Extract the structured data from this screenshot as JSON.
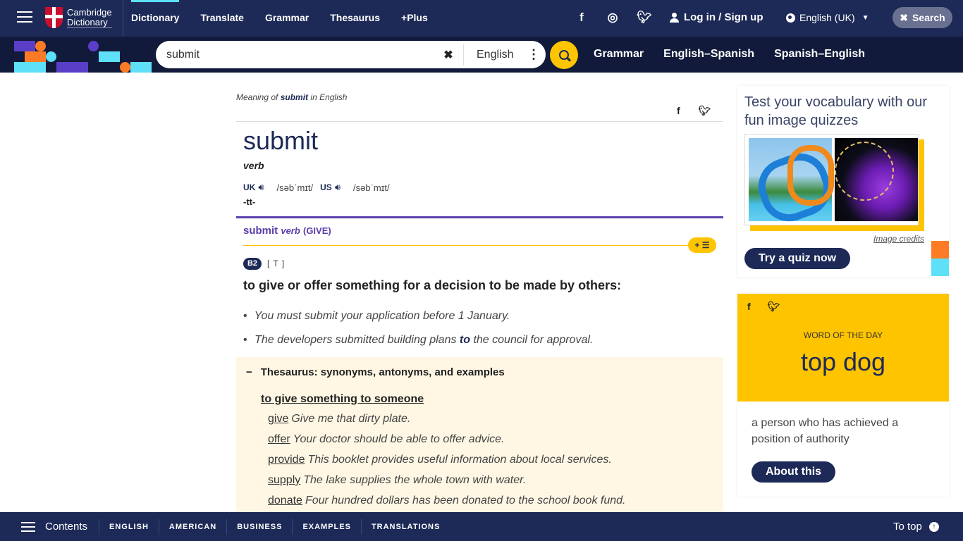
{
  "header": {
    "brand_line1": "Cambridge",
    "brand_line2": "Dictionary",
    "nav": [
      {
        "label": "Dictionary",
        "active": true
      },
      {
        "label": "Translate"
      },
      {
        "label": "Grammar"
      },
      {
        "label": "Thesaurus"
      },
      {
        "label": "+Plus"
      }
    ],
    "social": [
      "facebook-icon",
      "instagram-icon",
      "twitter-icon"
    ],
    "login_label": "Log in / Sign up",
    "language_label": "English (UK)",
    "search_toggle_label": "Search"
  },
  "searchbar": {
    "query": "submit",
    "dictionary_label": "English",
    "links": [
      "Grammar",
      "English–Spanish",
      "Spanish–English"
    ]
  },
  "entry": {
    "meaning_prefix": "Meaning of",
    "meaning_word": "submit",
    "meaning_suffix": "in English",
    "headword": "submit",
    "pos": "verb",
    "uk_label": "UK",
    "uk_ipa": "/səbˈmɪt/",
    "us_label": "US",
    "us_ipa": "/səbˈmɪt/",
    "grammar_note": "-tt-",
    "sense": {
      "word": "submit",
      "pos": "verb",
      "guideword": "(GIVE)",
      "level": "B2",
      "code": "[ T ]",
      "definition": "to give or offer something for a decision to be made by others:",
      "examples": [
        {
          "pre": "You must submit your application before 1 January.",
          "bold": "",
          "post": ""
        },
        {
          "pre": "The developers submitted building plans ",
          "bold": "to",
          "post": " the council for approval."
        }
      ]
    },
    "thesaurus": {
      "title": "Thesaurus: synonyms, antonyms, and examples",
      "subtitle": "to give something to someone",
      "items": [
        {
          "word": "give",
          "example": "Give me that dirty plate."
        },
        {
          "word": "offer",
          "example": "Your doctor should be able to offer advice."
        },
        {
          "word": "provide",
          "example": "This booklet provides useful information about local services."
        },
        {
          "word": "supply",
          "example": "The lake supplies the whole town with water."
        },
        {
          "word": "donate",
          "example": "Four hundred dollars has been donated to the school book fund."
        }
      ]
    }
  },
  "sidebar": {
    "quiz": {
      "title": "Test your vocabulary with our fun image quizzes",
      "image_credits": "Image credits",
      "button": "Try a quiz now"
    },
    "wotd": {
      "label": "WORD OF THE DAY",
      "word": "top dog",
      "definition": "a person who has achieved a position of authority",
      "button": "About this"
    }
  },
  "footer": {
    "contents_label": "Contents",
    "tabs": [
      "ENGLISH",
      "AMERICAN",
      "BUSINESS",
      "EXAMPLES",
      "TRANSLATIONS"
    ],
    "to_top": "To top"
  },
  "colors": {
    "navy": "#1d2a57",
    "yellow": "#fec400",
    "purple": "#5b3eaa",
    "cyan": "#5ee0f8",
    "orange": "#fe7b26",
    "thesaurus_bg": "#fff7e4"
  }
}
